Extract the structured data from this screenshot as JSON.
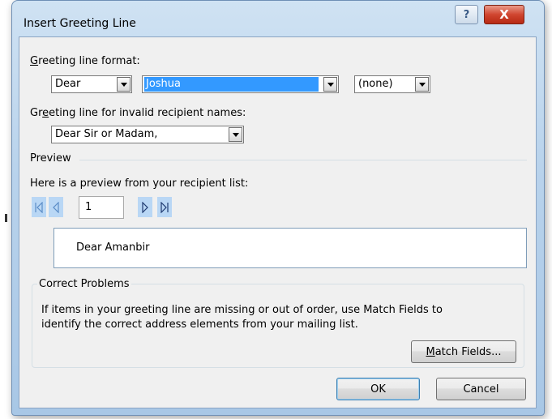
{
  "dialog": {
    "title": "Insert Greeting Line",
    "help_glyph": "?",
    "close_glyph": "X"
  },
  "greeting_format": {
    "label_first": "G",
    "label_rest": "reeting line format:",
    "salutation": "Dear",
    "name_format": "Joshua",
    "punctuation": "(none)"
  },
  "invalid_names": {
    "label_pre": "Gr",
    "label_u": "e",
    "label_rest": "eting line for invalid recipient names:",
    "value": "Dear Sir or Madam,"
  },
  "preview": {
    "section_label": "Preview",
    "description": "Here is a preview from your recipient list:",
    "record_number": "1",
    "text": "Dear Amanbir"
  },
  "correct_problems": {
    "title": "Correct Problems",
    "line1": "If items in your greeting line are missing or out of order, use Match Fields to",
    "line2": "identify the correct address elements from your mailing list.",
    "match_fields_u": "M",
    "match_fields_rest": "atch Fields..."
  },
  "buttons": {
    "ok": "OK",
    "cancel": "Cancel"
  },
  "colors": {
    "selection": "#3399ff",
    "nav_highlight": "#b9d7f5",
    "close_red": "#c8402b"
  }
}
